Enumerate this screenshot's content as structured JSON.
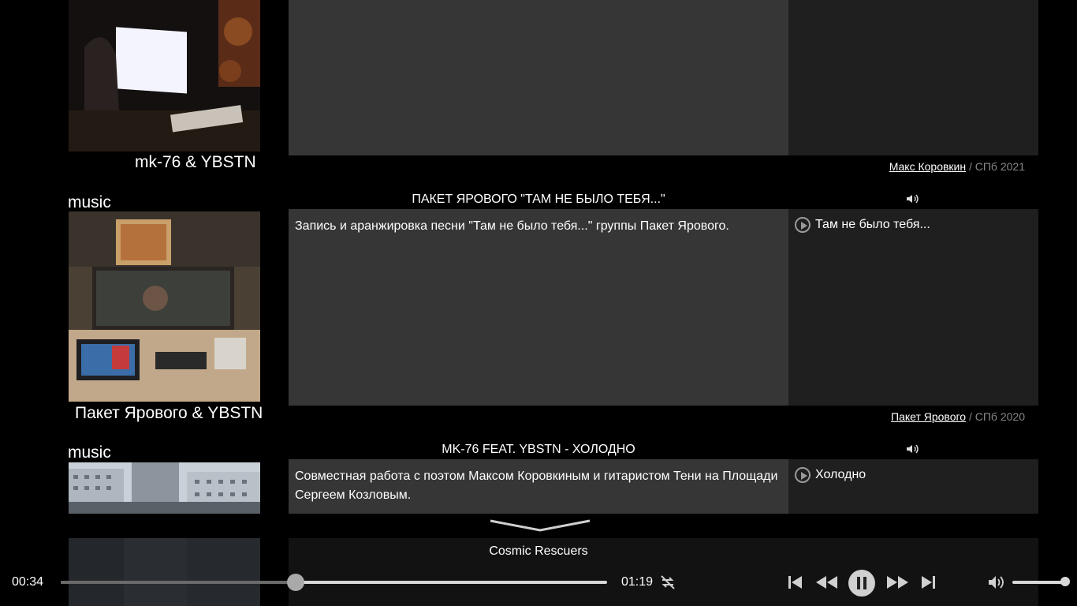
{
  "colors": {
    "background": "#000000",
    "description_bg": "#363636",
    "tracks_bg": "#1f1f1f",
    "text": "#ffffff",
    "muted": "#888888"
  },
  "items": [
    {
      "caption": "mk-76 & YBSTN",
      "credit": {
        "author": "Макс Коровкин",
        "place_year": " / СПб 2021"
      }
    },
    {
      "category": "music",
      "title": "ПАКЕТ ЯРОВОГО \"ТАМ НЕ БЫЛО ТЕБЯ...\"",
      "description": "Запись и аранжировка песни \"Там не было тебя...\" группы Пакет Ярового.",
      "caption": "Пакет Ярового & YBSTN",
      "tracks": [
        "Там не было тебя..."
      ],
      "credit": {
        "author": "Пакет Ярового",
        "place_year": " / СПб 2020"
      }
    },
    {
      "category": "music",
      "title": "MK-76 FEAT. YBSTN - ХОЛОДНО",
      "description": "Совместная работа с поэтом Максом Коровкиным и гитаристом Тени на Площади Сергеем Козловым.",
      "tracks": [
        "Холодно"
      ]
    }
  ],
  "player": {
    "now_playing": "Cosmic Rescuers",
    "current_time": "00:34",
    "total_time": "01:19",
    "progress_fraction": 0.43,
    "volume_fraction": 1.0,
    "repeat_icon": "repeat-off-icon",
    "state": "playing"
  }
}
